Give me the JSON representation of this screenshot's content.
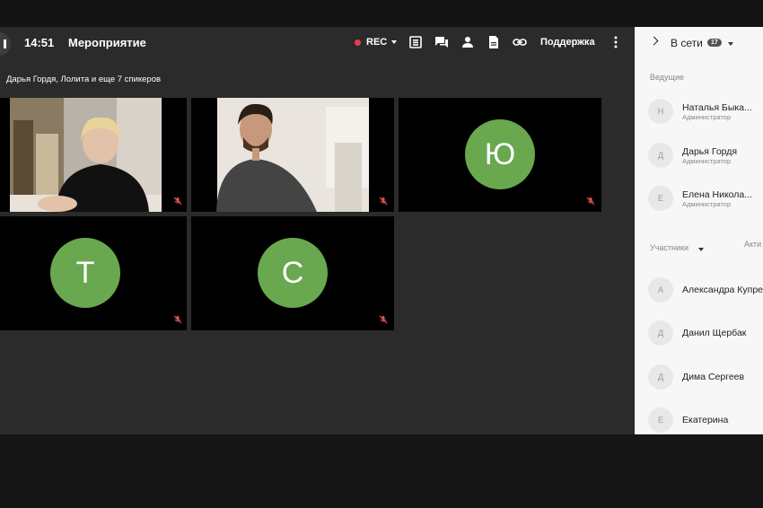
{
  "header": {
    "time": "14:51",
    "title": "Мероприятие",
    "rec_label": "REC",
    "support_label": "Поддержка"
  },
  "speakers_label": "Дарья Гордя, Лолита и еще 7 спикеров",
  "tiles": [
    {
      "type": "video",
      "name": "participant-video-woman"
    },
    {
      "type": "video",
      "name": "participant-video-man"
    },
    {
      "type": "avatar",
      "letter": "Ю"
    },
    {
      "type": "avatar",
      "letter": "Т"
    },
    {
      "type": "avatar",
      "letter": "С"
    }
  ],
  "sidebar": {
    "title": "В сети",
    "online_count": "17",
    "hosts_label": "Ведущие",
    "participants_label": "Участники",
    "active_label": "Акти",
    "hosts": [
      {
        "initial": "Н",
        "name": "Наталья Быка...",
        "role": "Администратор"
      },
      {
        "initial": "Д",
        "name": "Дарья Гордя",
        "role": "Администратор"
      },
      {
        "initial": "Е",
        "name": "Елена Никола...",
        "role": "Администратор"
      }
    ],
    "participants": [
      {
        "initial": "А",
        "name": "Александра Купре"
      },
      {
        "initial": "Д",
        "name": "Данил Щербак"
      },
      {
        "initial": "Д",
        "name": "Дима Сергеев"
      },
      {
        "initial": "Е",
        "name": "Екатерина"
      }
    ]
  },
  "colors": {
    "avatar_green": "#6aa84f",
    "rec_red": "#e0404a",
    "mic_muted": "#e05555"
  }
}
